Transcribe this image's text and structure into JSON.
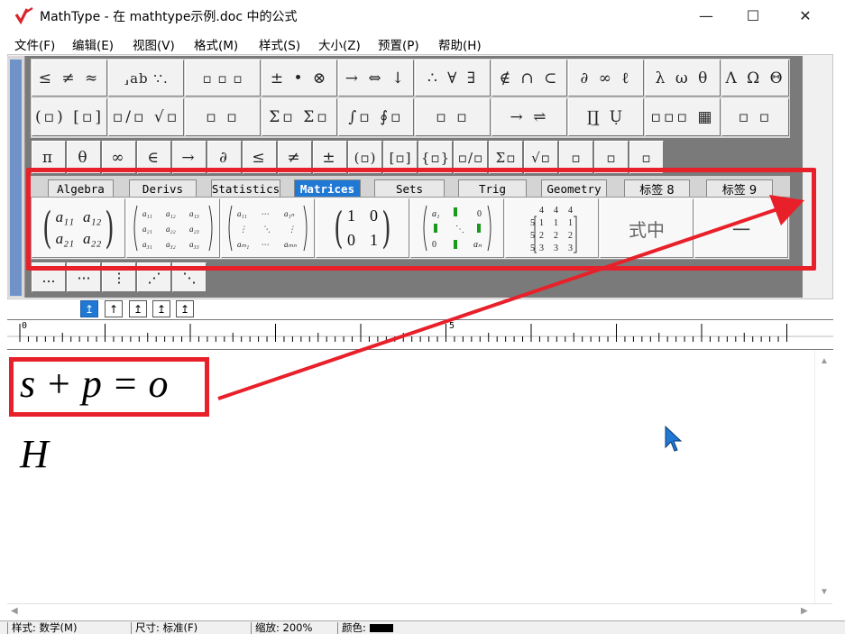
{
  "window": {
    "title": "MathType - 在 mathtype示例.doc 中的公式",
    "min_glyph": "—",
    "max_glyph": "☐",
    "close_glyph": "✕"
  },
  "menu": [
    "文件(F)",
    "编辑(E)",
    "视图(V)",
    "格式(M)",
    "样式(S)",
    "大小(Z)",
    "预置(P)",
    "帮助(H)"
  ],
  "palette_row1": [
    "≤ ≠ ≈",
    "⸥ab ∵.",
    "▫ ▫ ▫",
    "± • ⊗",
    "→ ⇔ ↓",
    "∴ ∀ ∃",
    "∉ ∩ ⊂",
    "∂ ∞ ℓ",
    "λ ω θ",
    "Λ Ω Θ"
  ],
  "palette_row2": [
    "(▫) [▫]",
    "▫/▫ √▫",
    "▫ ▫",
    "Σ▫ Σ▫",
    "∫▫ ∮▫",
    "▫ ▫",
    "→ ⇌",
    "∏̲ Ụ",
    "▫▫▫ ▦",
    "▫ ▫"
  ],
  "palette_row3": [
    "π",
    "θ",
    "∞",
    "∈",
    "→",
    "∂",
    "≤",
    "≠",
    "±",
    "(▫)",
    "[▫]",
    "{▫}",
    "▫/▫",
    "Σ▫",
    "√▫",
    "▫",
    "▫",
    "▫"
  ],
  "tabs": [
    "Algebra",
    "Derivs",
    "Statistics",
    "Matrices",
    "Sets",
    "Trig",
    "Geometry",
    "标签 8",
    "标签 9"
  ],
  "active_tab": "Matrices",
  "templates": {
    "m2x2": {
      "r1c1": "a₁₁",
      "r1c2": "a₁₂",
      "r2c1": "a₂₁",
      "r2c2": "a₂₂"
    },
    "identity": {
      "r1c1": "1",
      "r1c2": "0",
      "r2c1": "0",
      "r2c2": "1"
    },
    "ext_label": "式中",
    "tail_label": "一"
  },
  "dots_row": [
    "…",
    "⋯",
    "⋮",
    "⋰",
    "⋱"
  ],
  "nudge": [
    "↥",
    "↑",
    "↥",
    "↥",
    "↥"
  ],
  "ruler": {
    "zero": "0",
    "five": "5"
  },
  "equation": {
    "line1": "s + p = o",
    "line2": "H"
  },
  "status": {
    "style": "样式: 数学(M)",
    "size": "尺寸: 标准(F)",
    "zoom": "缩放: 200%",
    "color": "颜色:"
  },
  "colors": {
    "highlight": "#e8202a",
    "active_tab": "#1f78d4",
    "cursor": "#1f78d4"
  }
}
